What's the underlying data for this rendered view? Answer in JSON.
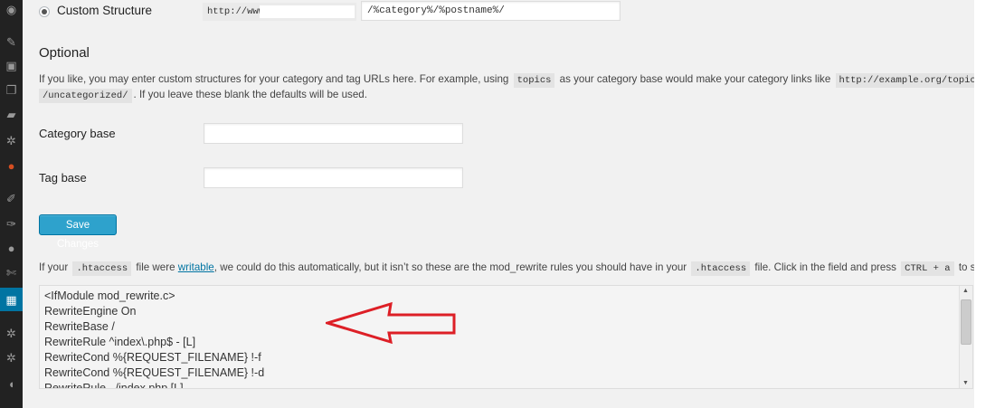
{
  "sidebar": {
    "icons": [
      "dashboard-icon",
      "pin-icon",
      "media-icon",
      "pages-icon",
      "comments-icon",
      "settings-icon",
      "plugin-badge-icon",
      "tools-icon",
      "plugins-icon",
      "users-icon",
      "wrench-icon",
      "settings-active-icon",
      "gear-icon",
      "gear-icon",
      "collapse-icon"
    ]
  },
  "permalink": {
    "option_label": "Custom Structure",
    "prefix": "http://www.",
    "structure_value": "/%category%/%postname%/"
  },
  "optional": {
    "heading": "Optional",
    "intro_1": "If you like, you may enter custom structures for your category and tag URLs here. For example, using ",
    "code_topics": "topics",
    "intro_2": " as your category base would make your category links like ",
    "code_example": "http://example.org/topics",
    "code_example_2": "/uncategorized/",
    "intro_3": ". If you leave these blank the defaults will be used."
  },
  "fields": {
    "category_base_label": "Category base",
    "category_base_value": "",
    "tag_base_label": "Tag base",
    "tag_base_value": ""
  },
  "actions": {
    "save_label": "Save Changes"
  },
  "htaccess": {
    "t1": "If your ",
    "code_htaccess": ".htaccess",
    "t2": " file were ",
    "link_writable": "writable",
    "t3": ", we could do this automatically, but it isn’t so these are the mod_rewrite rules you should have in your ",
    "code_htaccess_2": ".htaccess",
    "t4": " file. Click in the field and press ",
    "code_keys": "CTRL + a",
    "t5": " to select all.",
    "rules": [
      "<IfModule mod_rewrite.c>",
      "RewriteEngine On",
      "RewriteBase /",
      "RewriteRule ^index\\.php$ - [L]",
      "RewriteCond %{REQUEST_FILENAME} !-f",
      "RewriteCond %{REQUEST_FILENAME} !-d",
      "RewriteRule . /index.php [L]"
    ]
  },
  "colors": {
    "annotation_arrow": "#dd1f26",
    "primary_button": "#2ea2cc",
    "sidebar_bg": "#222222",
    "active_menu": "#0074a2"
  }
}
